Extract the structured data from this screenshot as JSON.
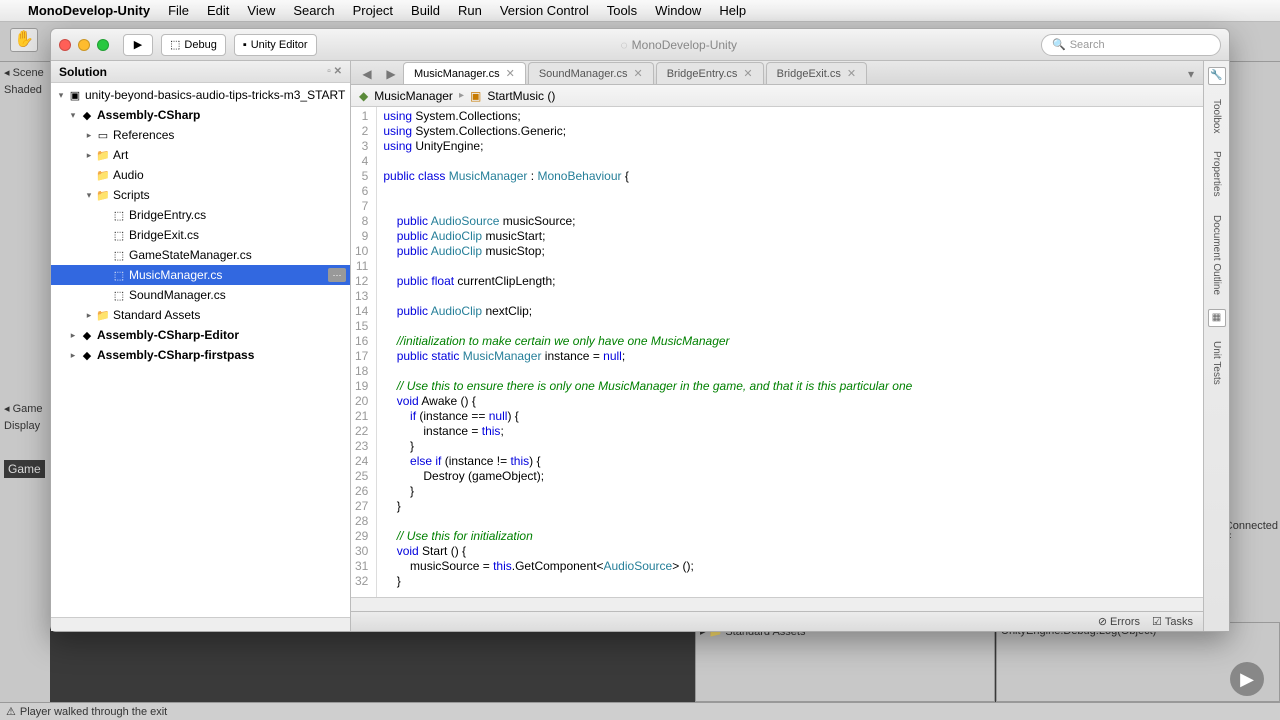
{
  "menubar": {
    "apple": "",
    "app": "MonoDevelop-Unity",
    "items": [
      "File",
      "Edit",
      "View",
      "Search",
      "Project",
      "Build",
      "Run",
      "Version Control",
      "Tools",
      "Window",
      "Help"
    ]
  },
  "toolbar": {
    "config": "Debug",
    "target": "Unity Editor",
    "title": "MonoDevelop-Unity",
    "search_placeholder": "Search"
  },
  "solution": {
    "title": "Solution",
    "project": "unity-beyond-basics-audio-tips-tricks-m3_START",
    "nodes": [
      {
        "indent": 1,
        "arrow": "▾",
        "icon": "◆",
        "label": "Assembly-CSharp",
        "bold": true
      },
      {
        "indent": 2,
        "arrow": "▸",
        "icon": "▭",
        "label": "References"
      },
      {
        "indent": 2,
        "arrow": "▸",
        "icon": "📁",
        "label": "Art"
      },
      {
        "indent": 2,
        "arrow": "",
        "icon": "📁",
        "label": "Audio"
      },
      {
        "indent": 2,
        "arrow": "▾",
        "icon": "📁",
        "label": "Scripts"
      },
      {
        "indent": 3,
        "arrow": "",
        "icon": "⬚",
        "label": "BridgeEntry.cs"
      },
      {
        "indent": 3,
        "arrow": "",
        "icon": "⬚",
        "label": "BridgeExit.cs"
      },
      {
        "indent": 3,
        "arrow": "",
        "icon": "⬚",
        "label": "GameStateManager.cs"
      },
      {
        "indent": 3,
        "arrow": "",
        "icon": "⬚",
        "label": "MusicManager.cs",
        "selected": true,
        "badge": "⋯"
      },
      {
        "indent": 3,
        "arrow": "",
        "icon": "⬚",
        "label": "SoundManager.cs"
      },
      {
        "indent": 2,
        "arrow": "▸",
        "icon": "📁",
        "label": "Standard Assets"
      },
      {
        "indent": 1,
        "arrow": "▸",
        "icon": "◆",
        "label": "Assembly-CSharp-Editor",
        "bold": true
      },
      {
        "indent": 1,
        "arrow": "▸",
        "icon": "◆",
        "label": "Assembly-CSharp-firstpass",
        "bold": true
      }
    ]
  },
  "tabs": [
    {
      "label": "MusicManager.cs",
      "active": true
    },
    {
      "label": "SoundManager.cs"
    },
    {
      "label": "BridgeEntry.cs"
    },
    {
      "label": "BridgeExit.cs"
    }
  ],
  "breadcrumb": {
    "class": "MusicManager",
    "member": "StartMusic ()"
  },
  "code": [
    {
      "n": 1,
      "seg": [
        [
          "kw",
          "using"
        ],
        [
          "",
          " System.Collections;"
        ]
      ]
    },
    {
      "n": 2,
      "seg": [
        [
          "kw",
          "using"
        ],
        [
          "",
          " System.Collections.Generic;"
        ]
      ]
    },
    {
      "n": 3,
      "seg": [
        [
          "kw",
          "using"
        ],
        [
          "",
          " UnityEngine;"
        ]
      ]
    },
    {
      "n": 4,
      "seg": [
        [
          "",
          ""
        ]
      ]
    },
    {
      "n": 5,
      "seg": [
        [
          "kw",
          "public class"
        ],
        [
          "",
          " "
        ],
        [
          "type",
          "MusicManager"
        ],
        [
          "",
          " : "
        ],
        [
          "type",
          "MonoBehaviour"
        ],
        [
          "",
          " {"
        ]
      ]
    },
    {
      "n": 6,
      "seg": [
        [
          "",
          ""
        ]
      ]
    },
    {
      "n": 7,
      "seg": [
        [
          "",
          ""
        ]
      ]
    },
    {
      "n": 8,
      "seg": [
        [
          "",
          "    "
        ],
        [
          "kw",
          "public"
        ],
        [
          "",
          " "
        ],
        [
          "type",
          "AudioSource"
        ],
        [
          "",
          " musicSource;"
        ]
      ]
    },
    {
      "n": 9,
      "seg": [
        [
          "",
          "    "
        ],
        [
          "kw",
          "public"
        ],
        [
          "",
          " "
        ],
        [
          "type",
          "AudioClip"
        ],
        [
          "",
          " musicStart;"
        ]
      ]
    },
    {
      "n": 10,
      "seg": [
        [
          "",
          "    "
        ],
        [
          "kw",
          "public"
        ],
        [
          "",
          " "
        ],
        [
          "type",
          "AudioClip"
        ],
        [
          "",
          " musicStop;"
        ]
      ]
    },
    {
      "n": 11,
      "seg": [
        [
          "",
          ""
        ]
      ]
    },
    {
      "n": 12,
      "seg": [
        [
          "",
          "    "
        ],
        [
          "kw",
          "public"
        ],
        [
          "",
          " "
        ],
        [
          "kw",
          "float"
        ],
        [
          "",
          " currentClipLength;"
        ]
      ]
    },
    {
      "n": 13,
      "seg": [
        [
          "",
          ""
        ]
      ]
    },
    {
      "n": 14,
      "seg": [
        [
          "",
          "    "
        ],
        [
          "kw",
          "public"
        ],
        [
          "",
          " "
        ],
        [
          "type",
          "AudioClip"
        ],
        [
          "",
          " nextClip;"
        ]
      ]
    },
    {
      "n": 15,
      "seg": [
        [
          "",
          ""
        ]
      ]
    },
    {
      "n": 16,
      "seg": [
        [
          "",
          "    "
        ],
        [
          "cm",
          "//initialization to make certain we only have one MusicManager"
        ]
      ]
    },
    {
      "n": 17,
      "seg": [
        [
          "",
          "    "
        ],
        [
          "kw",
          "public static"
        ],
        [
          "",
          " "
        ],
        [
          "type",
          "MusicManager"
        ],
        [
          "",
          " instance = "
        ],
        [
          "kw",
          "null"
        ],
        [
          "",
          ";"
        ]
      ]
    },
    {
      "n": 18,
      "seg": [
        [
          "",
          ""
        ]
      ]
    },
    {
      "n": 19,
      "seg": [
        [
          "",
          "    "
        ],
        [
          "cm",
          "// Use this to ensure there is only one MusicManager in the game, and that it is this particular one"
        ]
      ]
    },
    {
      "n": 20,
      "seg": [
        [
          "",
          "    "
        ],
        [
          "kw",
          "void"
        ],
        [
          "",
          " Awake () {"
        ]
      ]
    },
    {
      "n": 21,
      "seg": [
        [
          "",
          "        "
        ],
        [
          "kw",
          "if"
        ],
        [
          "",
          " (instance == "
        ],
        [
          "kw",
          "null"
        ],
        [
          "",
          ") {"
        ]
      ]
    },
    {
      "n": 22,
      "seg": [
        [
          "",
          "            instance = "
        ],
        [
          "kw",
          "this"
        ],
        [
          "",
          ";"
        ]
      ]
    },
    {
      "n": 23,
      "seg": [
        [
          "",
          "        }"
        ]
      ]
    },
    {
      "n": 24,
      "seg": [
        [
          "",
          "        "
        ],
        [
          "kw",
          "else if"
        ],
        [
          "",
          " (instance != "
        ],
        [
          "kw",
          "this"
        ],
        [
          "",
          ") {"
        ]
      ]
    },
    {
      "n": 25,
      "seg": [
        [
          "",
          "            Destroy (gameObject);"
        ]
      ]
    },
    {
      "n": 26,
      "seg": [
        [
          "",
          "        }"
        ]
      ]
    },
    {
      "n": 27,
      "seg": [
        [
          "",
          "    }"
        ]
      ]
    },
    {
      "n": 28,
      "seg": [
        [
          "",
          ""
        ]
      ]
    },
    {
      "n": 29,
      "seg": [
        [
          "",
          "    "
        ],
        [
          "cm",
          "// Use this for initialization"
        ]
      ]
    },
    {
      "n": 30,
      "seg": [
        [
          "",
          "    "
        ],
        [
          "kw",
          "void"
        ],
        [
          "",
          " Start () {"
        ]
      ]
    },
    {
      "n": 31,
      "seg": [
        [
          "",
          "        musicSource = "
        ],
        [
          "kw",
          "this"
        ],
        [
          "",
          ".GetComponent<"
        ],
        [
          "type",
          "AudioSource"
        ],
        [
          "",
          "> ();"
        ]
      ]
    },
    {
      "n": 32,
      "seg": [
        [
          "",
          "    }"
        ]
      ]
    }
  ],
  "statusbar": {
    "errors": "Errors",
    "tasks": "Tasks"
  },
  "rail": {
    "toolbox": "Toolbox",
    "properties": "Properties",
    "outline": "Document Outline",
    "tests": "Unit Tests"
  },
  "unity": {
    "scene_tab": "Scene",
    "shaded": "Shaded",
    "display": "Display",
    "game_tab": "Game",
    "connected": "Connected F",
    "standard_assets": "Standard Assets",
    "console_line": "UnityEngine.Debug:Log(Object)",
    "footer": "Player walked through the exit"
  }
}
